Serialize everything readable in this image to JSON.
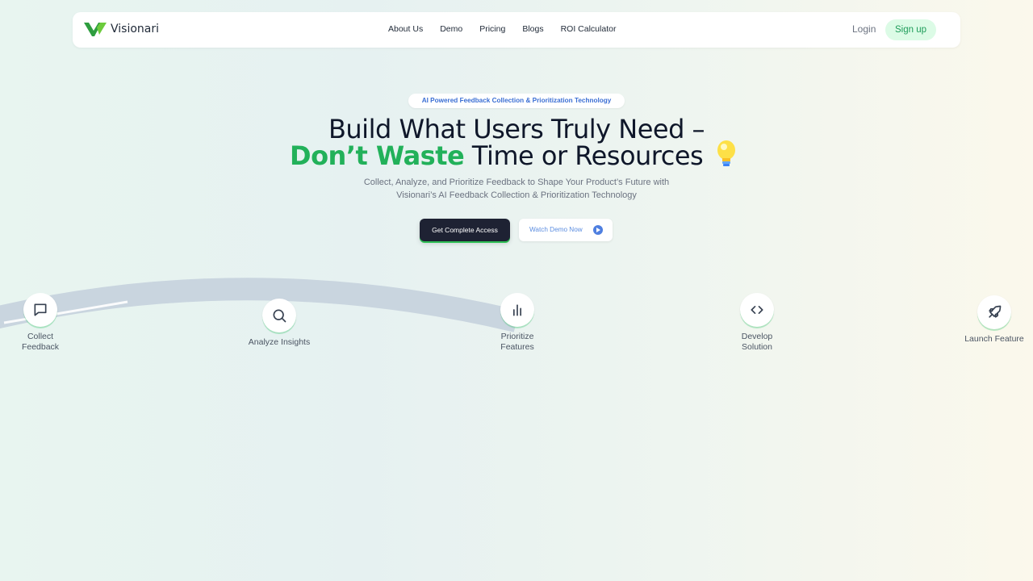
{
  "brand": {
    "name": "Visionari",
    "accent": "#22b15a",
    "logo_icon": "visionari-v-logo"
  },
  "nav": {
    "links": [
      "About Us",
      "Demo",
      "Pricing",
      "Blogs",
      "ROI Calculator"
    ],
    "login": "Login",
    "signup": "Sign up"
  },
  "hero": {
    "badge": "AI Powered Feedback Collection & Prioritization Technology",
    "headline_line1": "Build What Users Truly Need –",
    "headline_green": "Don’t Waste",
    "headline_rest": " Time or Resources",
    "subtitle_line1": "Collect, Analyze, and Prioritize Feedback to Shape Your Product’s Future with",
    "subtitle_line2": "Visionari’s AI Feedback Collection & Prioritization Technology",
    "cta_primary": "Get Complete Access",
    "cta_secondary": "Watch Demo Now"
  },
  "journey": {
    "steps": [
      {
        "label": "Collect\nFeedback",
        "icon": "message-square-icon"
      },
      {
        "label": "Analyze Insights",
        "icon": "search-icon"
      },
      {
        "label": "Prioritize\nFeatures",
        "icon": "bar-chart-icon"
      },
      {
        "label": "Develop\nSolution",
        "icon": "code-icon"
      },
      {
        "label": "Launch Feature",
        "icon": "rocket-icon"
      }
    ]
  }
}
